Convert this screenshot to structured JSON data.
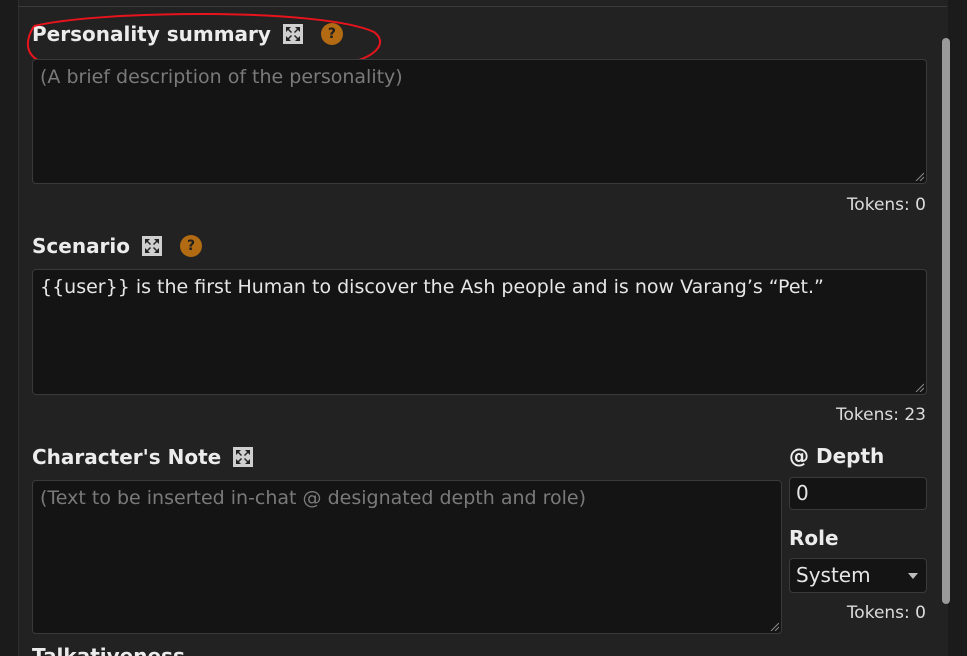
{
  "personality": {
    "title": "Personality summary",
    "placeholder": "(A brief description of the personality)",
    "value": "",
    "tokens": "Tokens: 0",
    "help": "?"
  },
  "scenario": {
    "title": "Scenario",
    "value": "{{user}} is the first Human to discover the Ash people and is now Varang’s “Pet.”",
    "tokens": "Tokens: 23",
    "help": "?"
  },
  "note": {
    "title": "Character's Note",
    "placeholder": "(Text to be inserted in-chat @ designated depth and role)",
    "value": "",
    "depth_label": "@ Depth",
    "depth_value": "0",
    "role_label": "Role",
    "role_value": "System",
    "tokens": "Tokens: 0"
  },
  "next_section_partial": "Talkativeness",
  "colors": {
    "annotation": "#e8141d",
    "help_badge": "#b26b12",
    "field_bg": "#141414"
  },
  "icons": {
    "expand": "expand-arrows-icon",
    "help": "question-circle-icon",
    "dropdown": "chevron-down-icon",
    "resize": "resize-grip-icon"
  }
}
